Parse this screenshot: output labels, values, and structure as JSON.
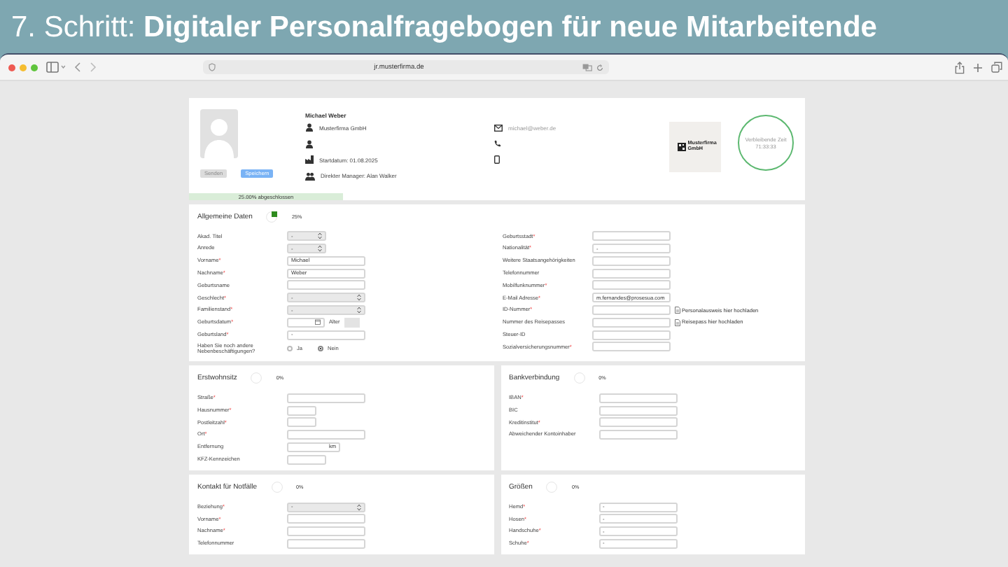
{
  "slide_title": "7. Schritt: **Digitaler Personalfragebogen für neue Mitarbeitende**",
  "browser": {
    "url": "jr.musterfirma.de"
  },
  "profile": {
    "name": "Michael Weber",
    "details": [
      {
        "kind": "person",
        "text": "Musterfirma GmbH"
      },
      {
        "kind": "person"
      },
      {
        "kind": "building",
        "text": "Startdatum: 01.08.2025"
      },
      {
        "kind": "group",
        "text": "Direkter Manager: Alan Walker"
      }
    ],
    "contacts": [
      {
        "kind": "mail",
        "text": "michael@weber.de"
      },
      {
        "kind": "phone"
      },
      {
        "kind": "mobile"
      }
    ],
    "buttons": [
      {
        "label": "Senden",
        "disabled": true
      },
      {
        "label": "Speichern",
        "disabled": false
      }
    ],
    "logo": "Musterfirma GmbH",
    "timer": {
      "label": "Verbleibende Zeit",
      "value": "71:33:33"
    },
    "progress": {
      "level": 0.25,
      "label": "25.00% abgeschlossen"
    }
  },
  "section_rows": [
    [
      {
        "title": "Allgemeine Daten",
        "percent": "25%",
        "columns": [
          [
            {
              "label": "Akad. Titel",
              "kind": "smallselect",
              "value": "-"
            },
            {
              "label": "Anrede",
              "kind": "smallselect",
              "value": "-"
            },
            {
              "label": "Vorname",
              "required_mark": "*",
              "kind": "text",
              "value": "Michael"
            },
            {
              "label": "Nachname",
              "required_mark": "*",
              "kind": "text",
              "value": "Weber"
            },
            {
              "label": "Geburtsname",
              "kind": "text"
            },
            {
              "label": "Geschlecht",
              "required_mark": "*",
              "kind": "select",
              "value": "-"
            },
            {
              "label": "Familienstand",
              "required_mark": "*",
              "kind": "select",
              "value": "-"
            },
            {
              "label": "Geburtsdatum",
              "required_mark": "*",
              "kind": "date",
              "extra": "Alter"
            },
            {
              "label": "Geburtsland",
              "required_mark": "*",
              "kind": "text",
              "value": "-"
            },
            {
              "label": "Haben Sie noch andere Nebenbeschäftigungen?",
              "kind": "radio",
              "options": [
                {
                  "label": "Ja",
                  "selected": false
                },
                {
                  "label": "Nein",
                  "selected": true
                }
              ]
            }
          ],
          [
            {
              "label": "Geburtsstadt",
              "required_mark": "*",
              "kind": "text"
            },
            {
              "label": "Nationalität",
              "required_mark": "*",
              "kind": "text",
              "value": "-"
            },
            {
              "label": "Weitere Staatsangehörigkeiten",
              "kind": "text"
            },
            {
              "label": "Telefonnummer",
              "kind": "text"
            },
            {
              "label": "Mobilfunknummer",
              "required_mark": "*",
              "kind": "text"
            },
            {
              "label": "E-Mail Adresse",
              "required_mark": "*",
              "kind": "text",
              "value": "m.fernandes@prosesua.com"
            },
            {
              "label": "ID-Nummer",
              "required_mark": "*",
              "kind": "upload",
              "extra": "Personalausweis hier hochladen"
            },
            {
              "label": "Nummer des Reisepasses",
              "kind": "upload",
              "extra": "Reisepass hier hochladen"
            },
            {
              "label": "Steuer-ID",
              "kind": "text"
            },
            {
              "label": "Sozialversicherungsnummer",
              "required_mark": "*",
              "kind": "text"
            }
          ]
        ]
      }
    ],
    [
      {
        "title": "Erstwohnsitz",
        "percent": "0%",
        "columns": [
          [
            {
              "label": "Straße",
              "required_mark": "*",
              "kind": "text"
            },
            {
              "label": "Hausnummer",
              "required_mark": "*",
              "kind": "short"
            },
            {
              "label": "Postleitzahl",
              "required_mark": "*",
              "kind": "short"
            },
            {
              "label": "Ort",
              "required_mark": "*",
              "kind": "text"
            },
            {
              "label": "Entfernung",
              "kind": "unit",
              "extra": "km"
            },
            {
              "label": "KFZ-Kennzeichen",
              "kind": "medium"
            }
          ]
        ]
      },
      {
        "title": "Bankverbindung",
        "percent": "0%",
        "columns": [
          [
            {
              "label": "IBAN",
              "required_mark": "*",
              "kind": "text"
            },
            {
              "label": "BIC",
              "kind": "text"
            },
            {
              "label": "Kreditinstitut",
              "required_mark": "*",
              "kind": "text"
            },
            {
              "label": "Abweichender Kontoinhaber",
              "kind": "text"
            }
          ]
        ]
      }
    ],
    [
      {
        "title": "Kontakt für Notfälle",
        "percent": "0%",
        "columns": [
          [
            {
              "label": "Beziehung",
              "required_mark": "*",
              "kind": "select",
              "value": "-"
            },
            {
              "label": "Vorname",
              "required_mark": "*",
              "kind": "text"
            },
            {
              "label": "Nachname",
              "required_mark": "*",
              "kind": "text"
            },
            {
              "label": "Telefonnummer",
              "kind": "text"
            }
          ]
        ]
      },
      {
        "title": "Größen",
        "percent": "0%",
        "columns": [
          [
            {
              "label": "Hemd",
              "required_mark": "*",
              "kind": "text",
              "value": "-"
            },
            {
              "label": "Hosen",
              "required_mark": "*",
              "kind": "text",
              "value": "-"
            },
            {
              "label": "Handschuhe",
              "required_mark": "*",
              "kind": "text",
              "value": "-"
            },
            {
              "label": "Schuhe",
              "required_mark": "*",
              "kind": "text",
              "value": "-"
            }
          ]
        ]
      }
    ]
  ]
}
